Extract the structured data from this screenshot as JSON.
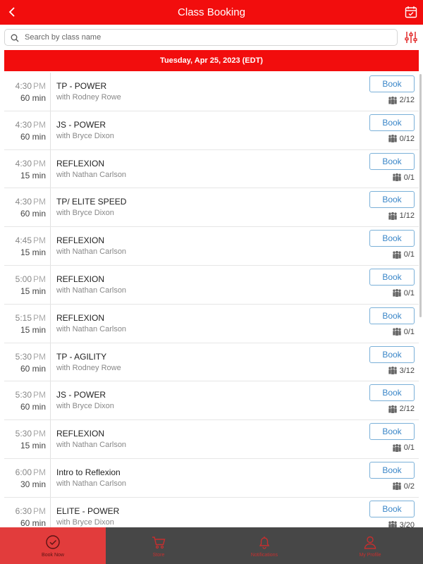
{
  "header": {
    "title": "Class Booking",
    "back_icon": "chevron-left-icon",
    "calendar_icon": "calendar-check-icon"
  },
  "search": {
    "placeholder": "Search by class name",
    "value": "",
    "filter_icon": "sliders-icon"
  },
  "date_bar": {
    "label": "Tuesday, Apr 25, 2023 (EDT)"
  },
  "colors": {
    "brand": "#f20d0d",
    "book_button": "#3a86c8",
    "tabbar": "#474747",
    "tab_active": "#e23c3c"
  },
  "classes": [
    {
      "time": "4:30",
      "ampm": "PM",
      "duration": "60 min",
      "name": "TP - POWER",
      "coach": "with Rodney Rowe",
      "book": "Book",
      "capacity": "2/12"
    },
    {
      "time": "4:30",
      "ampm": "PM",
      "duration": "60 min",
      "name": "JS - POWER",
      "coach": "with Bryce Dixon",
      "book": "Book",
      "capacity": "0/12"
    },
    {
      "time": "4:30",
      "ampm": "PM",
      "duration": "15 min",
      "name": "REFLEXION",
      "coach": "with Nathan Carlson",
      "book": "Book",
      "capacity": "0/1"
    },
    {
      "time": "4:30",
      "ampm": "PM",
      "duration": "60 min",
      "name": "TP/ ELITE SPEED",
      "coach": "with Bryce Dixon",
      "book": "Book",
      "capacity": "1/12"
    },
    {
      "time": "4:45",
      "ampm": "PM",
      "duration": "15 min",
      "name": "REFLEXION",
      "coach": "with Nathan Carlson",
      "book": "Book",
      "capacity": "0/1"
    },
    {
      "time": "5:00",
      "ampm": "PM",
      "duration": "15 min",
      "name": "REFLEXION",
      "coach": "with Nathan Carlson",
      "book": "Book",
      "capacity": "0/1"
    },
    {
      "time": "5:15",
      "ampm": "PM",
      "duration": "15 min",
      "name": "REFLEXION",
      "coach": "with Nathan Carlson",
      "book": "Book",
      "capacity": "0/1"
    },
    {
      "time": "5:30",
      "ampm": "PM",
      "duration": "60 min",
      "name": "TP - AGILITY",
      "coach": "with Rodney Rowe",
      "book": "Book",
      "capacity": "3/12"
    },
    {
      "time": "5:30",
      "ampm": "PM",
      "duration": "60 min",
      "name": "JS - POWER",
      "coach": "with Bryce Dixon",
      "book": "Book",
      "capacity": "2/12"
    },
    {
      "time": "5:30",
      "ampm": "PM",
      "duration": "15 min",
      "name": "REFLEXION",
      "coach": "with Nathan Carlson",
      "book": "Book",
      "capacity": "0/1"
    },
    {
      "time": "6:00",
      "ampm": "PM",
      "duration": "30 min",
      "name": "Intro to Reflexion",
      "coach": "with Nathan Carlson",
      "book": "Book",
      "capacity": "0/2"
    },
    {
      "time": "6:30",
      "ampm": "PM",
      "duration": "60 min",
      "name": "ELITE - POWER",
      "coach": "with Bryce Dixon",
      "book": "Book",
      "capacity": "3/20"
    }
  ],
  "tabs": [
    {
      "label": "Book Now",
      "icon": "check-circle-icon",
      "active": true
    },
    {
      "label": "Store",
      "icon": "cart-icon",
      "active": false
    },
    {
      "label": "Notifications",
      "icon": "bell-icon",
      "active": false
    },
    {
      "label": "My Profile",
      "icon": "user-icon",
      "active": false
    }
  ]
}
